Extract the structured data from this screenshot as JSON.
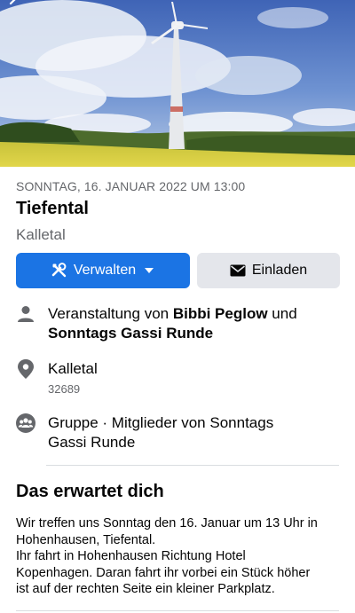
{
  "event": {
    "date": "SONNTAG, 16. JANUAR 2022 UM 13:00",
    "title": "Tiefental",
    "location_subtitle": "Kalletal"
  },
  "actions": {
    "manage_label": "Verwalten",
    "invite_label": "Einladen"
  },
  "details": {
    "host_prefix": "Veranstaltung von ",
    "host_one": "Bibbi Peglow",
    "host_join": " und",
    "host_two": "Sonntags Gassi Runde",
    "place_name": "Kalletal",
    "place_postcode": "32689",
    "group_line1": "Gruppe · Mitglieder von Sonntags",
    "group_line2": "Gassi Runde"
  },
  "about": {
    "heading": "Das erwartet dich",
    "lines": [
      "Wir treffen uns Sonntag den 16. Januar um 13 Uhr in",
      "Hohenhausen, Tiefental.",
      "Ihr fahrt in Hohenhausen Richtung Hotel",
      "Kopenhagen. Daran fahrt ihr vorbei ein Stück höher",
      "ist auf der rechten Seite ein kleiner Parkplatz."
    ]
  },
  "icons": {
    "back": "arrow-left-icon",
    "manage": "tools-icon",
    "dropdown": "caret-down-icon",
    "invite": "envelope-icon",
    "host": "person-icon",
    "place": "map-pin-icon",
    "group": "group-icon"
  },
  "colors": {
    "primary": "#1b74e4",
    "secondary_button": "#e4e6eb",
    "muted_text": "#65676b",
    "icon_gray": "#65676b"
  }
}
